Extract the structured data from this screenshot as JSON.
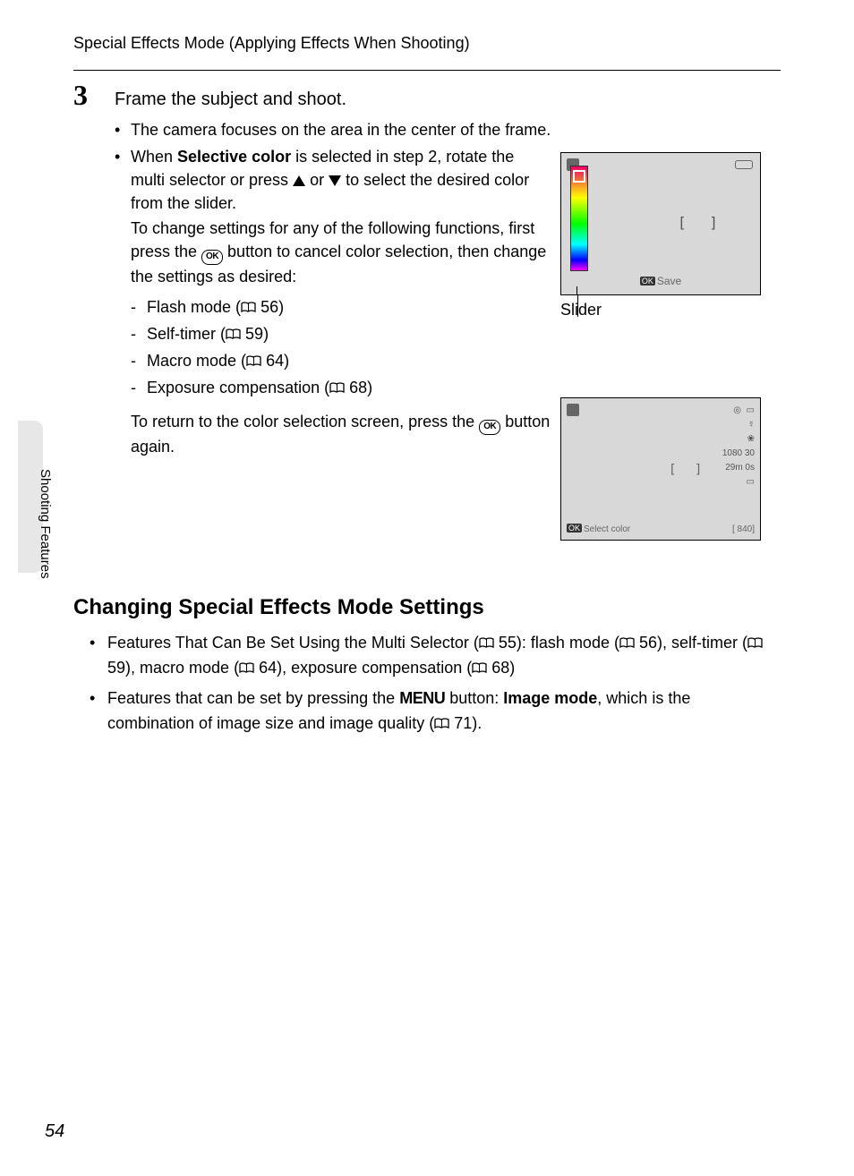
{
  "header": "Special Effects Mode (Applying Effects When Shooting)",
  "step": {
    "number": "3",
    "title": "Frame the subject and shoot.",
    "bullet1": "The camera focuses on the area in the center of the frame.",
    "bullet2_pre": "When ",
    "bullet2_bold": "Selective color",
    "bullet2_mid": " is selected in step 2, rotate the multi selector or press ",
    "bullet2_or": " or ",
    "bullet2_post": " to select the desired color from the slider.",
    "change_intro_pre": "To change settings for any of the following functions, first press the ",
    "change_intro_post": " button to cancel color selection, then change the settings as desired:",
    "dash_items": [
      {
        "label_pre": "Flash mode (",
        "page": "56",
        "label_post": ")"
      },
      {
        "label_pre": "Self-timer (",
        "page": "59",
        "label_post": ")"
      },
      {
        "label_pre": "Macro mode (",
        "page": "64",
        "label_post": ")"
      },
      {
        "label_pre": "Exposure compensation (",
        "page": "68",
        "label_post": ")"
      }
    ],
    "return_pre": "To return to the color selection screen, press the ",
    "return_post": " button again."
  },
  "ok_label": "OK",
  "slider_caption": "Slider",
  "screen1": {
    "save": "Save",
    "brackets": "[  ]"
  },
  "screen2": {
    "brackets": "[  ]",
    "rec_res": "1080 30",
    "rec_time": "29m 0s",
    "select_color": "Select color",
    "count": "[  840]"
  },
  "section2": {
    "title": "Changing Special Effects Mode Settings",
    "item1_pre": "Features That Can Be Set Using the Multi Selector (",
    "item1_p1": "55",
    "item1_mid1": "): flash mode (",
    "item1_p2": "56",
    "item1_mid2": "), self-timer (",
    "item1_p3": "59",
    "item1_mid3": "), macro mode (",
    "item1_p4": "64",
    "item1_mid4": "), exposure compensation (",
    "item1_p5": "68",
    "item1_end": ")",
    "item2_pre": "Features that can be set by pressing the ",
    "item2_menu": "MENU",
    "item2_mid": " button: ",
    "item2_bold": "Image mode",
    "item2_mid2": ", which is the combination of image size and image quality (",
    "item2_page": "71",
    "item2_end": ")."
  },
  "side_label": "Shooting Features",
  "page_number": "54"
}
